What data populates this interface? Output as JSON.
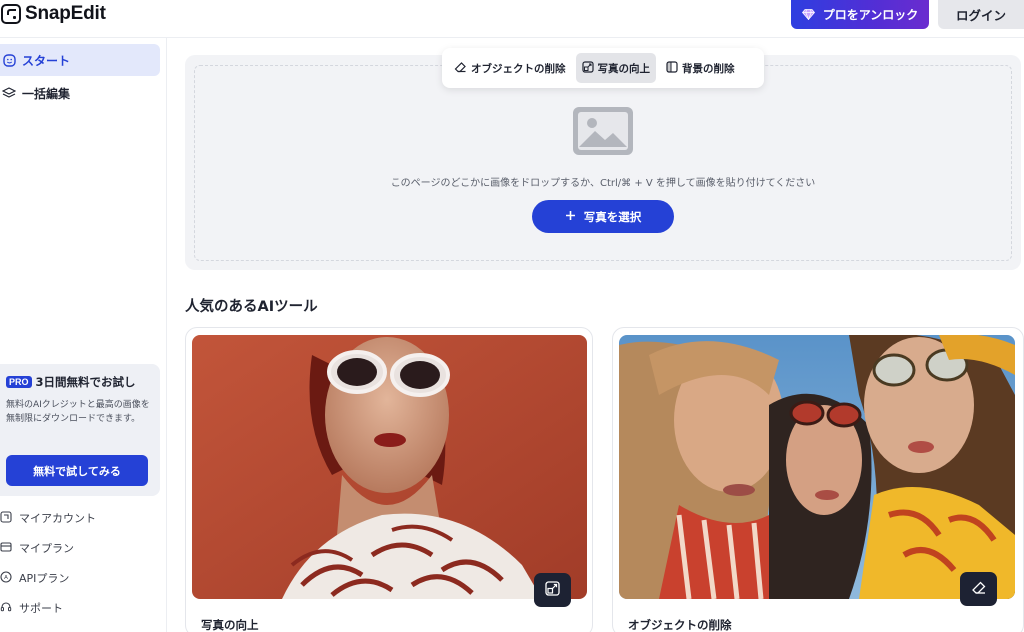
{
  "app": {
    "logo_text": "SnapEdit"
  },
  "header": {
    "pro_button": "プロをアンロック",
    "login_button": "ログイン"
  },
  "sidebar": {
    "nav": [
      {
        "label": "スタート",
        "icon": "smile-icon",
        "active": true
      },
      {
        "label": "一括編集",
        "icon": "layers-icon",
        "active": false
      }
    ],
    "promo": {
      "badge": "PRO",
      "title": "3日間無料でお試し",
      "description": "無料のAIクレジットと最高の画像を無制限にダウンロードできます。",
      "button": "無料で試してみる"
    },
    "account": [
      {
        "label": "マイアカウント",
        "icon": "account-icon"
      },
      {
        "label": "マイプラン",
        "icon": "card-icon"
      },
      {
        "label": "APIプラン",
        "icon": "api-icon"
      },
      {
        "label": "サポート",
        "icon": "headset-icon"
      }
    ]
  },
  "tool_tabs": [
    {
      "label": "オブジェクトの削除",
      "icon": "eraser-icon",
      "active": false
    },
    {
      "label": "写真の向上",
      "icon": "enhance-icon",
      "active": true
    },
    {
      "label": "背景の削除",
      "icon": "bg-remove-icon",
      "active": false
    }
  ],
  "dropzone": {
    "instruction": "このページのどこかに画像をドロップするか、Ctrl/⌘ + V を押して画像を貼り付けてください",
    "select_button": "写真を選択",
    "select_icon": "plus-icon"
  },
  "section": {
    "title": "人気のあるAIツール"
  },
  "cards": [
    {
      "label": "写真の向上",
      "action_icon": "enhance-icon"
    },
    {
      "label": "オブジェクトの削除",
      "action_icon": "eraser-icon"
    }
  ],
  "colors": {
    "primary": "#2541d6",
    "pro_gradient_start": "#2e3fe0",
    "pro_gradient_end": "#6a2ccf",
    "active_nav_bg": "#e3e8fb"
  }
}
